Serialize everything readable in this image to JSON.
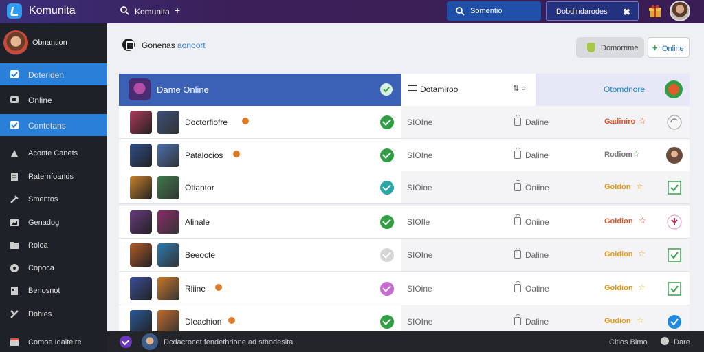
{
  "app": {
    "name": "Komunita"
  },
  "topbar": {
    "title": "Komunita",
    "plus": "+",
    "search_button_label": "Somentio",
    "dashboard_button_label": "Dobdindarodes"
  },
  "sidebar": {
    "user_name": "Obnantion",
    "items": [
      {
        "label": "Doteriden",
        "icon": "inbox-icon",
        "active": true
      },
      {
        "label": "Online",
        "icon": "chat-icon",
        "active": false
      },
      {
        "label": "Contetans",
        "icon": "contacts-icon",
        "active": true
      },
      {
        "label": "Aconte Canets",
        "icon": "settings-icon",
        "active": false
      },
      {
        "label": "Raternfoands",
        "icon": "list-icon",
        "active": false
      },
      {
        "label": "Smentos",
        "icon": "wrench-icon",
        "active": false
      },
      {
        "label": "Genadog",
        "icon": "image-icon",
        "active": false
      },
      {
        "label": "Roloa",
        "icon": "folder-icon",
        "active": false
      },
      {
        "label": "Copoca",
        "icon": "globe-icon",
        "active": false
      },
      {
        "label": "Benosnot",
        "icon": "document-icon",
        "active": false
      },
      {
        "label": "Dohies",
        "icon": "tools-icon",
        "active": false
      }
    ],
    "footer_label": "Comoe Idaiteire"
  },
  "main": {
    "breadcrumb_a": "Gonenas",
    "breadcrumb_b": "aonoort",
    "domo_button_label": "Domorrime",
    "online_button_label": "Online",
    "online_button_icon": "+"
  },
  "table": {
    "header": {
      "left_label": "Dame Online",
      "mid_label": "Dotamiroo",
      "mid_sort": "⇅ ○",
      "right_label": "Otomdnore"
    },
    "rows": [
      {
        "name": "Doctorfiofre",
        "badge": true,
        "check_color": "#2f9e44",
        "status": "SIOIne",
        "online": "Daline",
        "rank": "Gadiniro",
        "rank_color": "#e2552b",
        "star": "☆",
        "star_color": "#e2552b",
        "action": "refresh-icon"
      },
      {
        "name": "Patalocios",
        "badge": true,
        "check_color": "#2f9e44",
        "status": "SIOIne",
        "online": "Daline",
        "rank": "Rodiom",
        "rank_color": "#777",
        "star": "☆",
        "star_color": "#5a9e5a",
        "action": "avatar-icon"
      },
      {
        "name": "Otiantor",
        "badge": false,
        "check_color": "#2aa8a8",
        "status": "SIOine",
        "online": "Oniine",
        "rank": "Goldon",
        "rank_color": "#e89a1a",
        "star": "☆",
        "star_color": "#e89a1a",
        "action": "checkbox-icon"
      },
      {
        "name": "Alinale",
        "badge": false,
        "check_color": "#2f9e44",
        "status": "SIOIle",
        "online": "Oniine",
        "rank": "Goldion",
        "rank_color": "#e2552b",
        "star": "☆",
        "star_color": "#e2552b",
        "action": "clover-icon"
      },
      {
        "name": "Beeocte",
        "badge": false,
        "check_color": "#d6d6d6",
        "status": "SIOIne",
        "online": "Daline",
        "rank": "Goldion",
        "rank_color": "#e89a1a",
        "star": "☆",
        "star_color": "#e89a1a",
        "action": "checkbox-icon"
      },
      {
        "name": "Rliine",
        "badge": true,
        "check_color": "#c86ad4",
        "status": "SIOine",
        "online": "Oaline",
        "rank": "Goldion",
        "rank_color": "#e89a1a",
        "star": "☆",
        "star_color": "#e8c21a",
        "action": "checkbox-icon"
      },
      {
        "name": "Dleachion",
        "badge": true,
        "check_color": "#2f9e44",
        "status": "SIOIne",
        "online": "Daline",
        "rank": "Gudion",
        "rank_color": "#e89a1a",
        "star": "☆",
        "star_color": "#e8c21a",
        "action": "check-circle-icon"
      }
    ]
  },
  "footer": {
    "message": "Dcdacrocet fendethrione ad stbodesita",
    "stats": "Cltios Bimo",
    "help_label": "Dare"
  }
}
